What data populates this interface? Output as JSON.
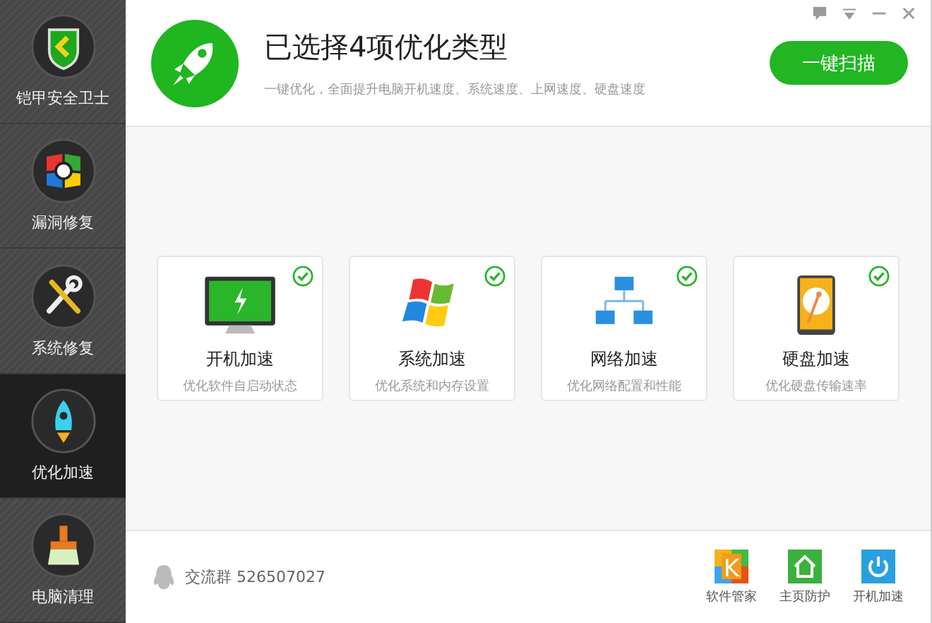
{
  "sidebar": {
    "items": [
      {
        "label": "铠甲安全卫士",
        "selected": false
      },
      {
        "label": "漏洞修复",
        "selected": false
      },
      {
        "label": "系统修复",
        "selected": false
      },
      {
        "label": "优化加速",
        "selected": true
      },
      {
        "label": "电脑清理",
        "selected": false
      }
    ]
  },
  "header": {
    "title": "已选择4项优化类型",
    "subtitle": "一键优化，全面提升电脑开机速度、系统速度、上网速度、硬盘速度",
    "button": "一键扫描"
  },
  "cards": [
    {
      "title": "开机加速",
      "description": "优化软件自启动状态",
      "checked": true
    },
    {
      "title": "系统加速",
      "description": "优化系统和内存设置",
      "checked": true
    },
    {
      "title": "网络加速",
      "description": "优化网络配置和性能",
      "checked": true
    },
    {
      "title": "硬盘加速",
      "description": "优化硬盘传输速率",
      "checked": true
    }
  ],
  "footer": {
    "group": "交流群 526507027",
    "apps": [
      {
        "label": "软件管家",
        "glyph": "K"
      },
      {
        "label": "主页防护"
      },
      {
        "label": "开机加速"
      }
    ]
  }
}
